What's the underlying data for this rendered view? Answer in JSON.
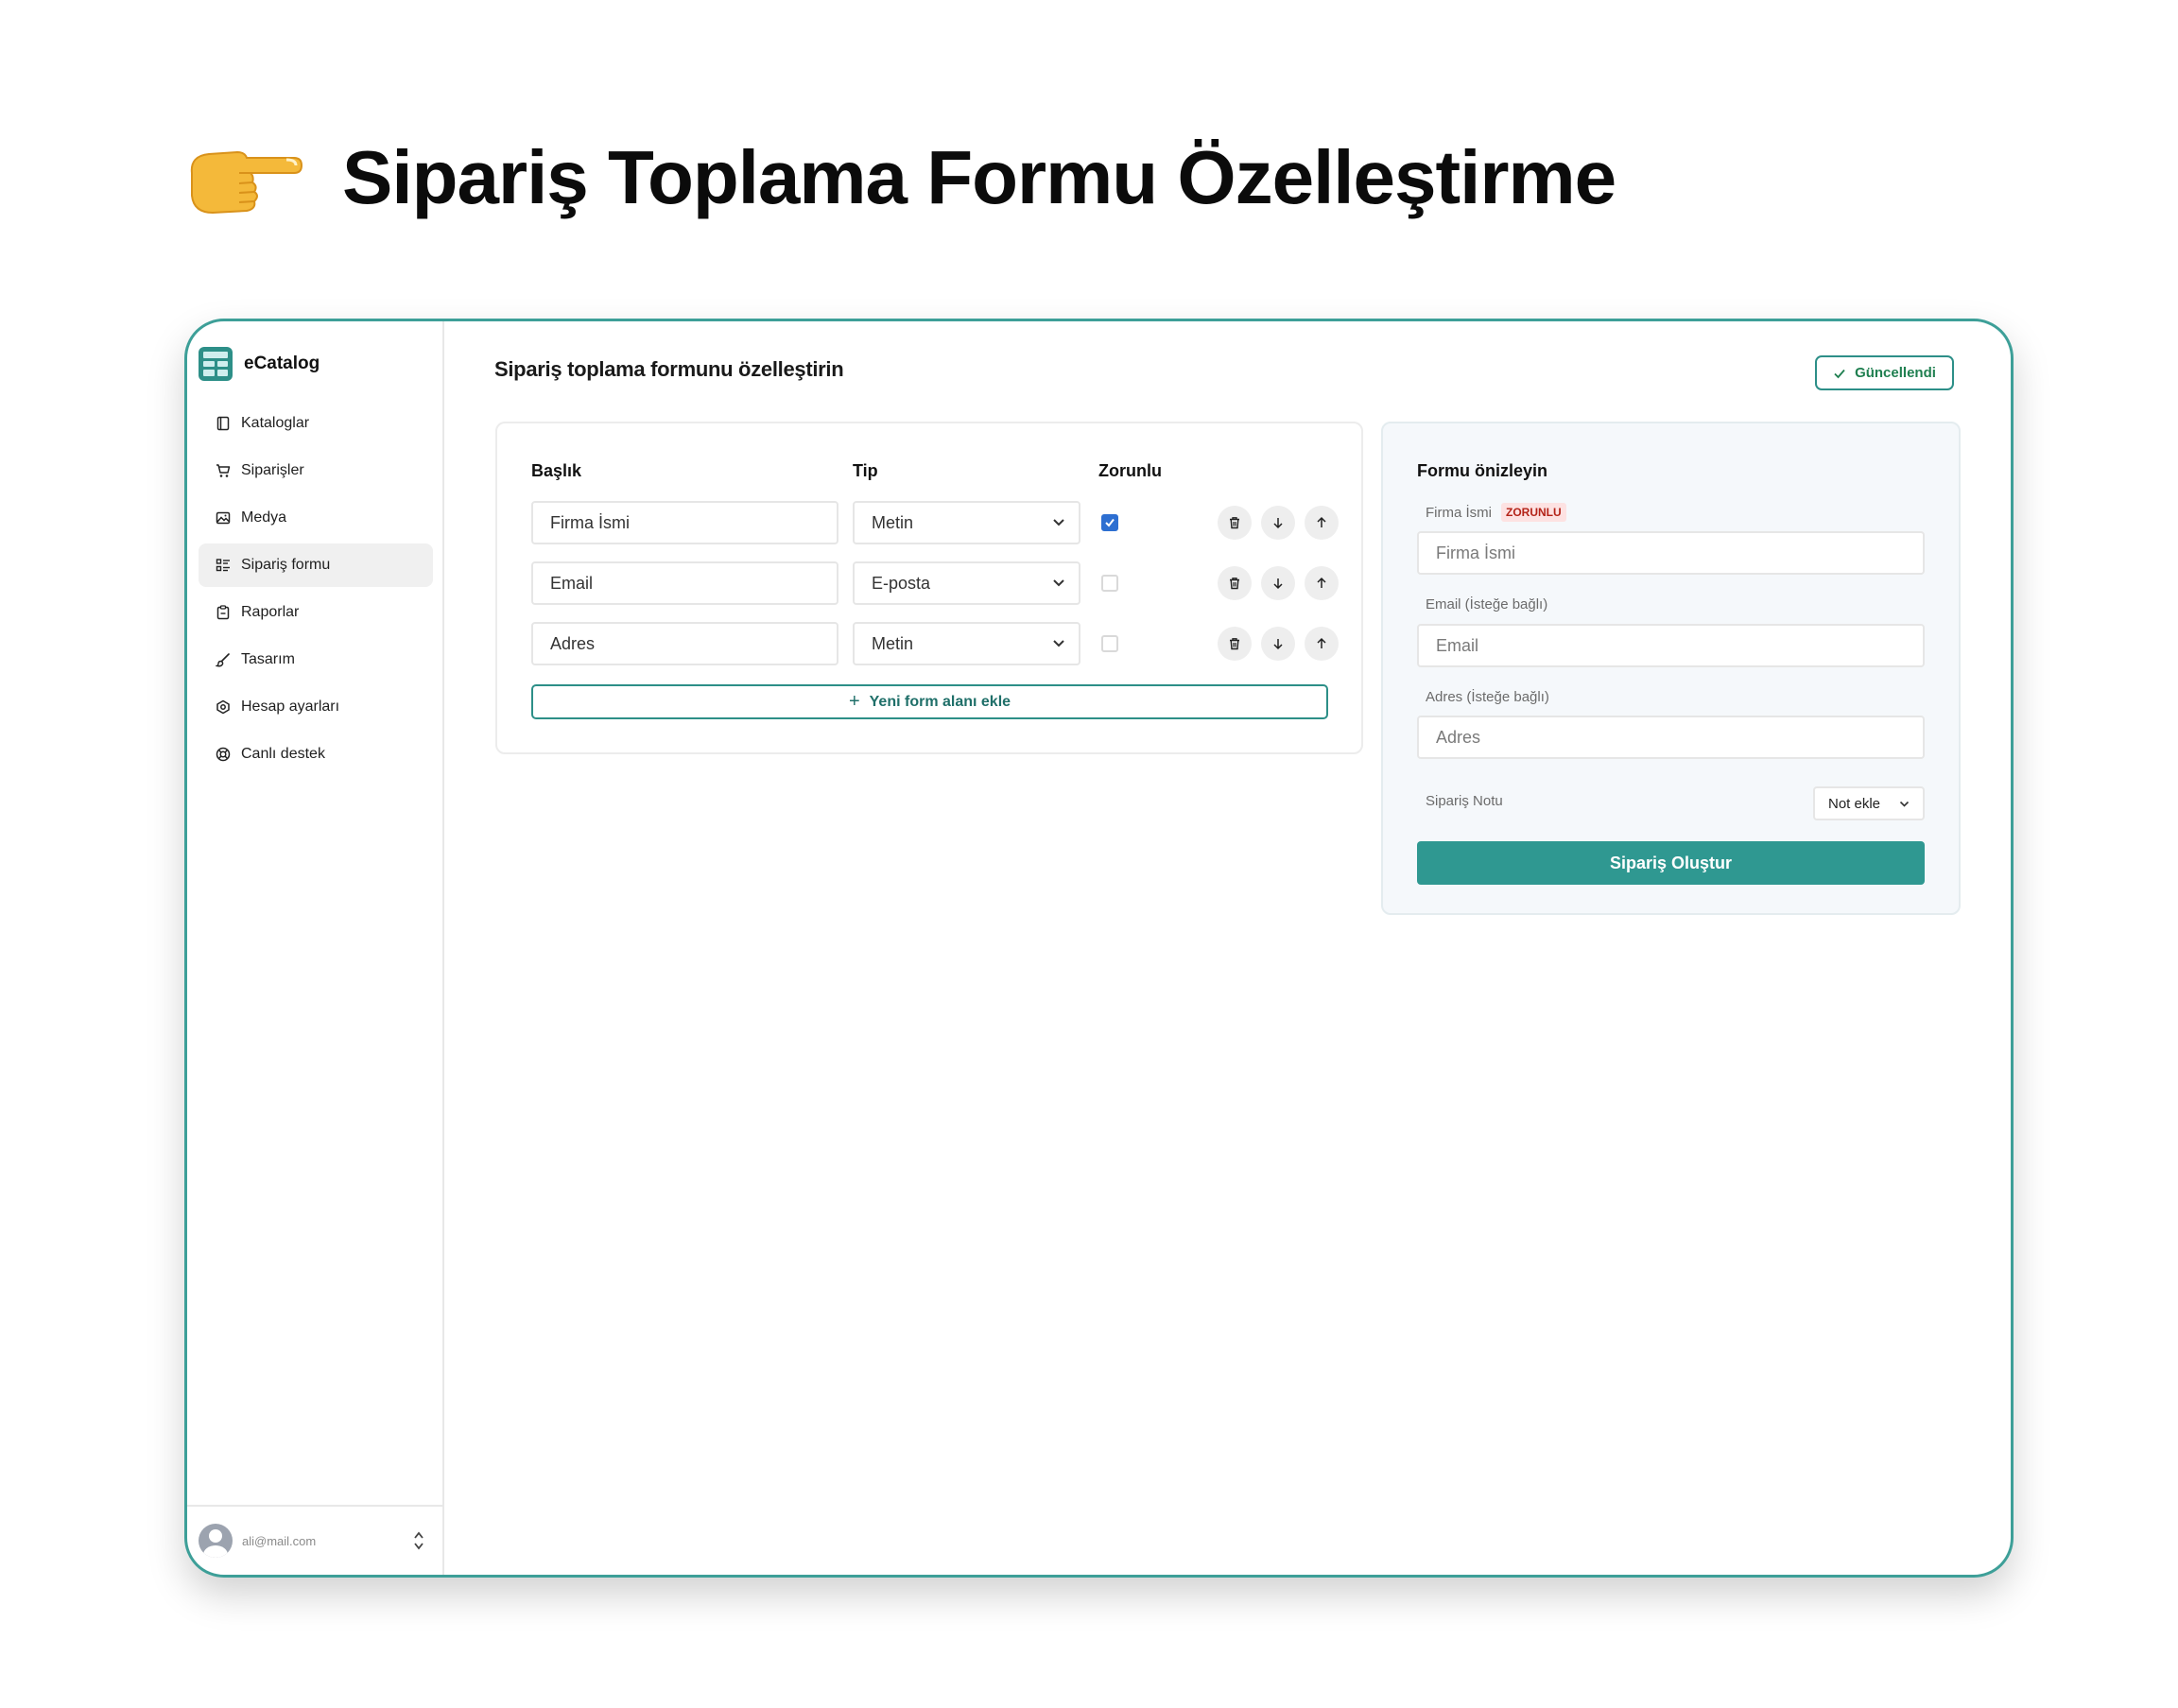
{
  "headline": {
    "emoji_icon": "pointing-hand-icon",
    "text": "Sipariş Toplama Formu Özelleştirme"
  },
  "colors": {
    "accent": "#2f9891",
    "frame_border": "#3d9f98",
    "checkbox_checked": "#2d6fd1",
    "required_badge_bg": "#fde2e2",
    "required_badge_text": "#b42318",
    "updated_text": "#1f7f50"
  },
  "sidebar": {
    "brand": "eCatalog",
    "items": [
      {
        "label": "Kataloglar",
        "icon": "book-icon",
        "active": false
      },
      {
        "label": "Siparişler",
        "icon": "cart-icon",
        "active": false
      },
      {
        "label": "Medya",
        "icon": "image-icon",
        "active": false
      },
      {
        "label": "Sipariş formu",
        "icon": "form-list-icon",
        "active": true
      },
      {
        "label": "Raporlar",
        "icon": "clipboard-icon",
        "active": false
      },
      {
        "label": "Tasarım",
        "icon": "brush-icon",
        "active": false
      },
      {
        "label": "Hesap ayarları",
        "icon": "settings-hex-icon",
        "active": false
      },
      {
        "label": "Canlı destek",
        "icon": "lifebuoy-icon",
        "active": false
      }
    ],
    "user_email": "ali@mail.com"
  },
  "main": {
    "title": "Sipariş toplama formunu özelleştirin",
    "updated_label": "Güncellendi"
  },
  "editor": {
    "columns": {
      "title": "Başlık",
      "type": "Tip",
      "required": "Zorunlu"
    },
    "rows": [
      {
        "title": "Firma İsmi",
        "type": "Metin",
        "required": true
      },
      {
        "title": "Email",
        "type": "E-posta",
        "required": false
      },
      {
        "title": "Adres",
        "type": "Metin",
        "required": false
      }
    ],
    "add_field_label": "Yeni form alanı ekle"
  },
  "preview": {
    "title": "Formu önizleyin",
    "fields": [
      {
        "label": "Firma İsmi",
        "badge": "ZORUNLU",
        "placeholder": "Firma İsmi"
      },
      {
        "label": "Email (İsteğe bağlı)",
        "badge": "",
        "placeholder": "Email"
      },
      {
        "label": "Adres (İsteğe bağlı)",
        "badge": "",
        "placeholder": "Adres"
      }
    ],
    "note_label": "Sipariş Notu",
    "note_button": "Not ekle",
    "submit_label": "Sipariş Oluştur"
  }
}
